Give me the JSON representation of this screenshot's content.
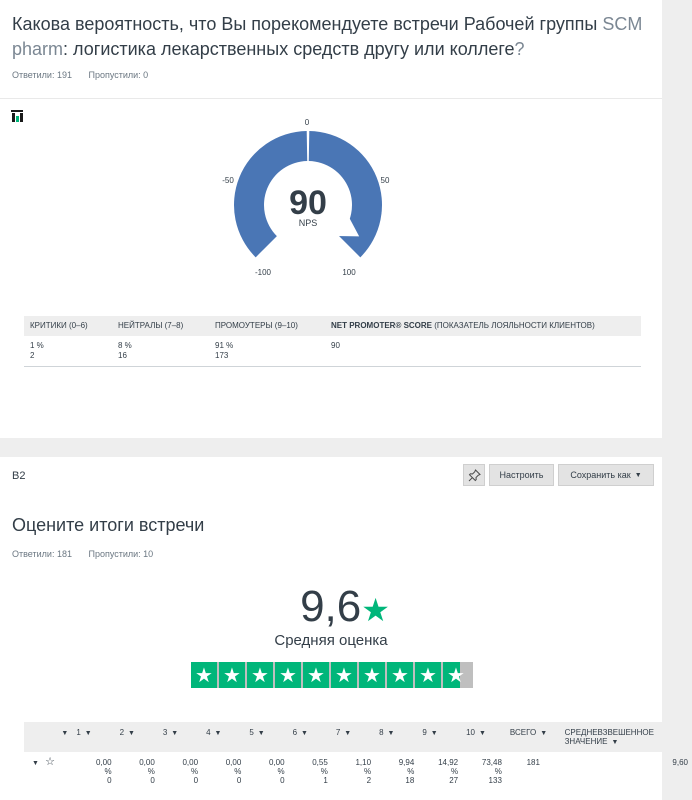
{
  "q1": {
    "title_main": "Какова вероятность, что Вы порекомендуете встречи Рабочей группы ",
    "title_highlight": "SCM pharm",
    "title_tail": ": логистика лекарственных средств другу или коллеге",
    "title_qmark": "?",
    "answered": "Ответили: 191",
    "skipped": "Пропустили: 0",
    "gauge": {
      "labels": [
        "0",
        "50",
        "100",
        "-100",
        "-50"
      ],
      "score": "90",
      "score_caption": "NPS",
      "min": -100,
      "max": 100,
      "color": "#4a76b5"
    },
    "table": {
      "headers": [
        "КРИТИКИ (0–6)",
        "НЕЙТРАЛЫ (7–8)",
        "ПРОМОУТЕРЫ (9–10)"
      ],
      "header_nps_bold": "NET PROMOTER® SCORE",
      "header_nps_rest": " (ПОКАЗАТЕЛЬ ЛОЯЛЬНОСТИ КЛИЕНТОВ)",
      "percents": [
        "1 %",
        "8 %",
        "91 %"
      ],
      "counts": [
        "2",
        "16",
        "173"
      ],
      "nps_value": "90"
    }
  },
  "q2": {
    "id_label": "B2",
    "buttons": {
      "customize": "Настроить",
      "save_as": "Сохранить как"
    },
    "title": "Оцените итоги встречи",
    "answered": "Ответили: 181",
    "skipped": "Пропустили: 10",
    "average": "9,6",
    "average_caption": "Средняя оценка",
    "star_fill": 0.96,
    "star_color": "#00b67a",
    "table": {
      "headers": [
        "1",
        "2",
        "3",
        "4",
        "5",
        "6",
        "7",
        "8",
        "9",
        "10",
        "ВСЕГО",
        "СРЕДНЕВЗВЕШЕННОЕ ЗНАЧЕНИЕ"
      ],
      "percents": [
        "0,00",
        "0,00",
        "0,00",
        "0,00",
        "0,00",
        "0,55",
        "1,10",
        "9,94",
        "14,92",
        "73,48"
      ],
      "counts": [
        "0",
        "0",
        "0",
        "0",
        "0",
        "1",
        "2",
        "18",
        "27",
        "133"
      ],
      "total": "181",
      "weighted": "9,60",
      "percent_sign": "%"
    }
  }
}
